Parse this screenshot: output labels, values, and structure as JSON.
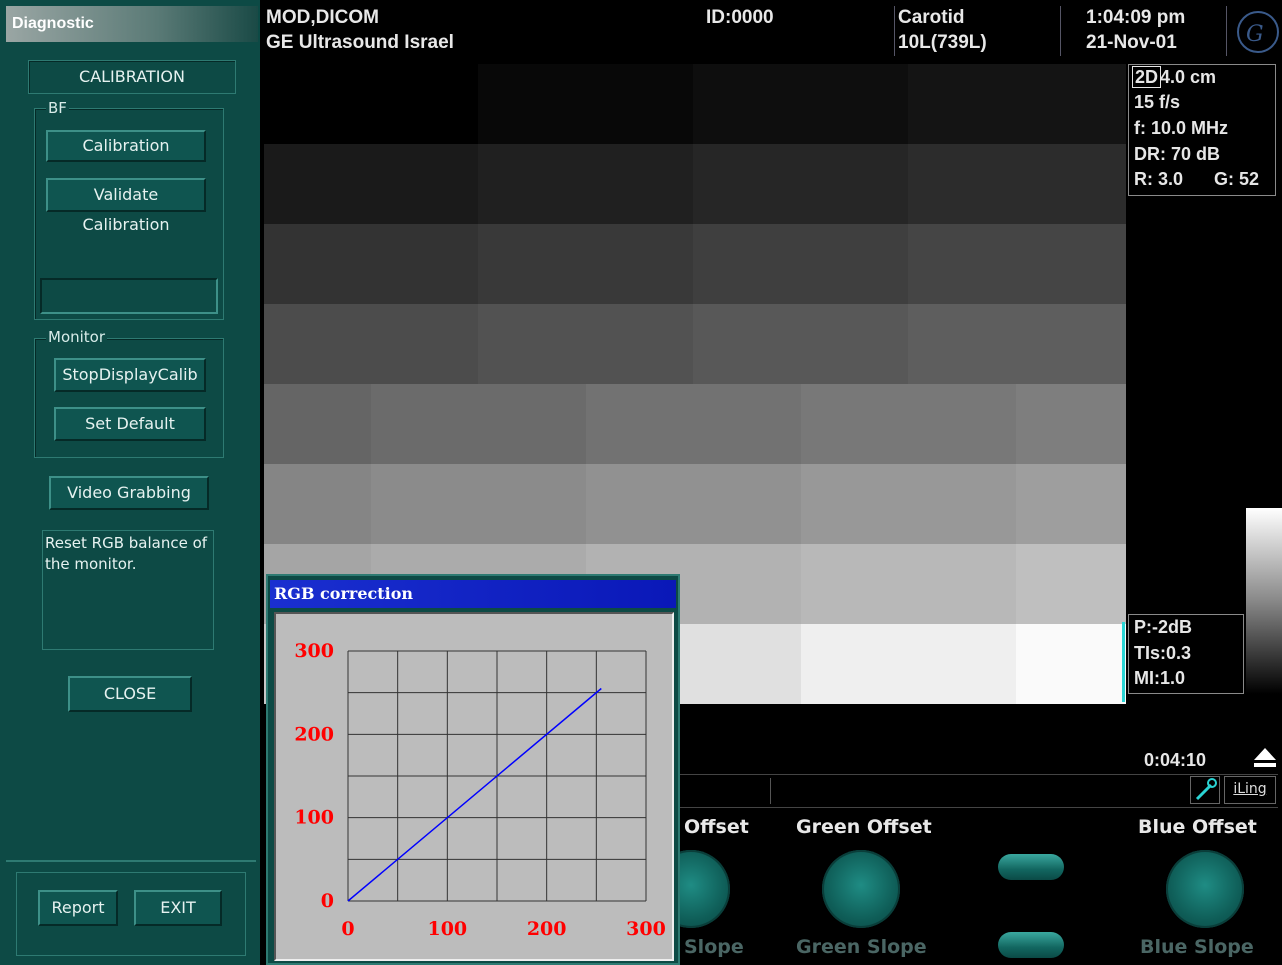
{
  "left_panel": {
    "title": "Diagnostic",
    "section_header": "CALIBRATION",
    "bf_group": {
      "label": "BF",
      "calibration_button": "Calibration",
      "validate_button": "Validate Calibration",
      "status_field": ""
    },
    "monitor_group": {
      "label": "Monitor",
      "stop_button": "StopDisplayCalib",
      "default_button": "Set Default"
    },
    "video_button": "Video Grabbing",
    "description": "Reset RGB balance of the monitor.",
    "close_button": "CLOSE",
    "report_button": "Report",
    "exit_button": "EXIT"
  },
  "header": {
    "line1_left": "MOD,DICOM",
    "line2_left": "GE Ultrasound Israel",
    "id": "ID:0000",
    "preset": "Carotid",
    "probe": "10L(739L)",
    "time": "1:04:09 pm",
    "date": "21-Nov-01"
  },
  "imaging_info": {
    "mode": "2D",
    "depth": "4.0 cm",
    "frame_rate": "15 f/s",
    "frequency": "f: 10.0 MHz",
    "dynamic_range": "DR: 70 dB",
    "r_value": "R: 3.0",
    "gain": "G: 52",
    "power": "P:-2dB",
    "tis": "TIs:0.3",
    "mi": "MI:1.0",
    "cine_time": "0:04:10",
    "iling_label": "iLing"
  },
  "rgb_dialog": {
    "title": "RGB correction"
  },
  "chart_data": {
    "type": "line",
    "title": "",
    "xlabel": "",
    "ylabel": "",
    "xlim": [
      0,
      300
    ],
    "ylim": [
      0,
      300
    ],
    "x_ticks": [
      "0",
      "100",
      "200",
      "300"
    ],
    "y_ticks": [
      "0",
      "100",
      "200",
      "300"
    ],
    "grid": true,
    "series": [
      {
        "x": [
          0,
          255
        ],
        "y": [
          0,
          255
        ],
        "color": "#0000ff"
      }
    ]
  },
  "softkeys": {
    "red_offset": "Offset",
    "green_offset": "Green Offset",
    "blue_offset": "Blue Offset",
    "red_slope": "Slope",
    "green_slope": "Green Slope",
    "blue_slope": "Blue Slope"
  },
  "colors": {
    "panel_bg": "#0d4a45",
    "titlebar_blue": "#0a18b8",
    "chart_tick_red": "#ff0000",
    "line_blue": "#0000ff"
  }
}
